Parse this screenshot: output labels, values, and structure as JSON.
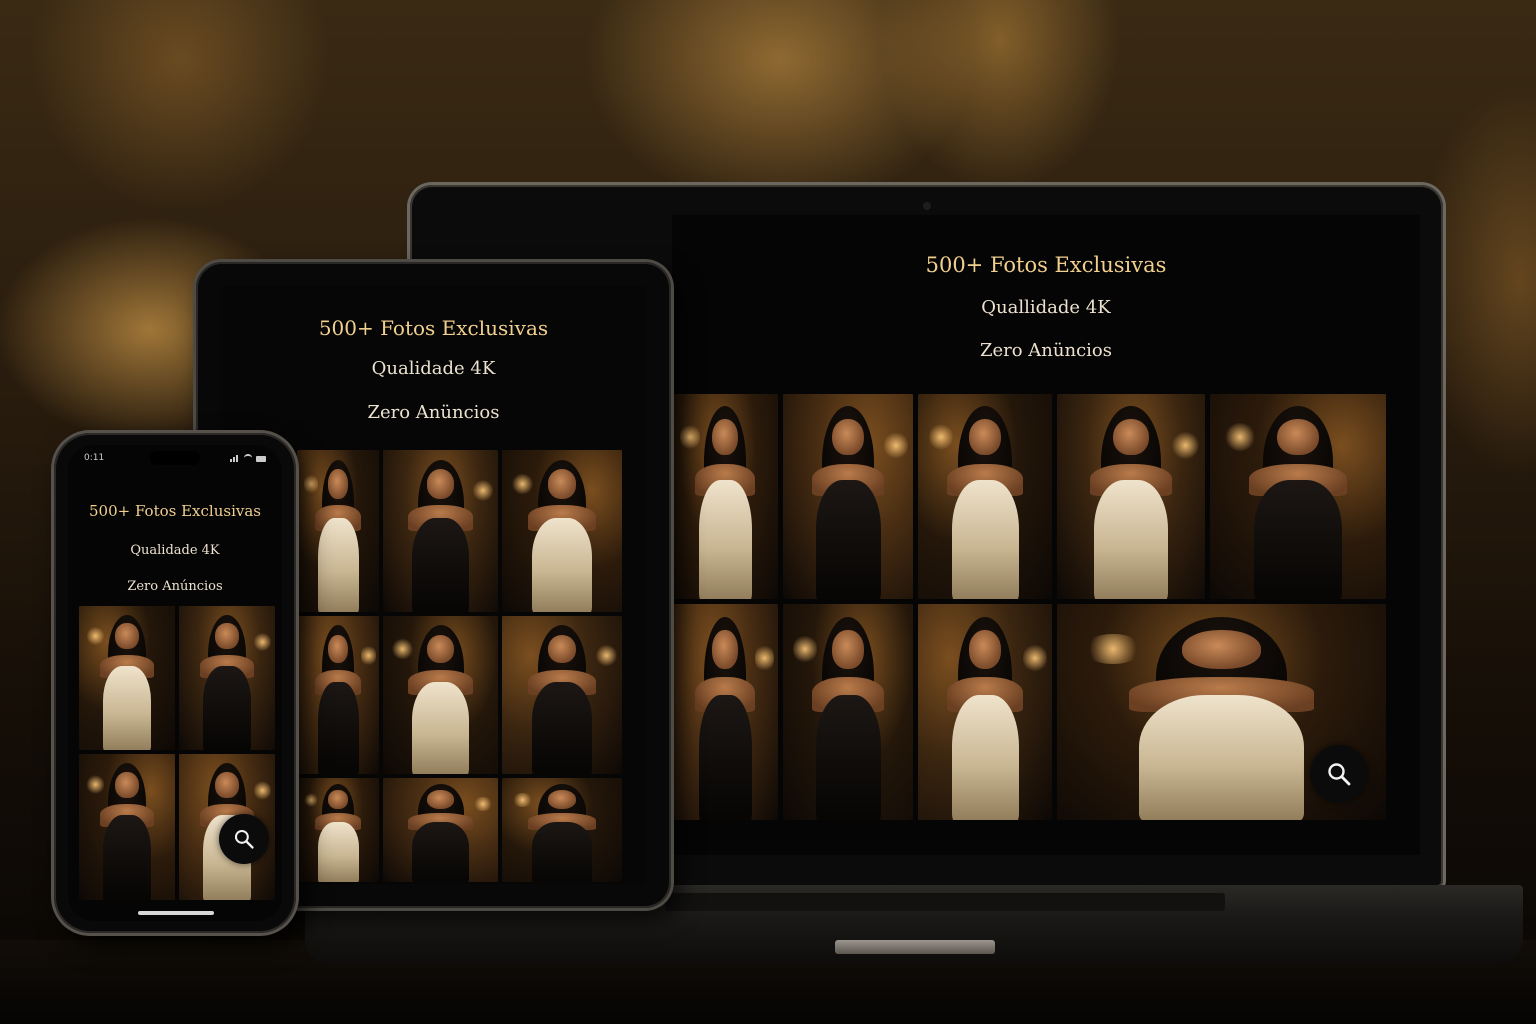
{
  "laptop": {
    "headline": "500+ Fotos Exclusivas",
    "line2": "Quallidade 4K",
    "line3": "Zero Anüncios"
  },
  "tablet": {
    "headline": "500+ Fotos Exclusivas",
    "line2": "Qualidade 4K",
    "line3": "Zero Anüncios"
  },
  "phone": {
    "time": "0:11",
    "headline": "500+ Fotos Exclusivas",
    "line2": "Qualidade 4K",
    "line3": "Zero Anúncios"
  },
  "search_icon": "search-icon",
  "colors": {
    "headline_gold": "#f1cf8e",
    "text_cream": "#ece2cf",
    "screen_bg": "#050505"
  },
  "galleries": {
    "laptop": [
      "white-dress",
      "black-dress",
      "white-dress",
      "white-dress",
      "black-dress",
      "black-dress",
      "black-dress",
      "white-dress",
      "white-dress"
    ],
    "tablet": [
      "white-dress",
      "black-dress",
      "white-dress",
      "black-dress",
      "white-dress",
      "black-dress",
      "white-dress",
      "black-dress",
      "black-dress"
    ],
    "phone": [
      "white-dress",
      "black-dress",
      "black-dress",
      "white-dress"
    ]
  }
}
